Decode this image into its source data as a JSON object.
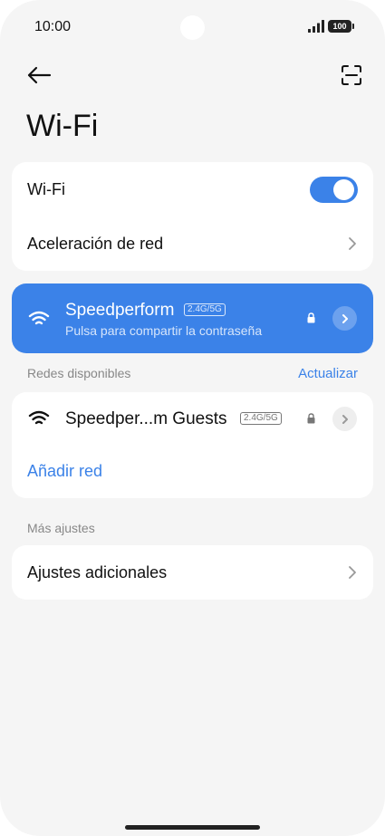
{
  "status_bar": {
    "time": "10:00",
    "battery": "100"
  },
  "header": {
    "title": "Wi-Fi"
  },
  "settings": {
    "wifi_label": "Wi-Fi",
    "wifi_enabled": true,
    "network_acceleration_label": "Aceleración de red"
  },
  "connected_network": {
    "name": "Speedperform",
    "band": "2.4G/5G",
    "subtitle": "Pulsa para compartir la contraseña",
    "secured": true
  },
  "available": {
    "section_label": "Redes disponibles",
    "refresh_label": "Actualizar",
    "networks": [
      {
        "name": "Speedper...m Guests",
        "band": "2.4G/5G",
        "secured": true
      }
    ],
    "add_network_label": "Añadir red"
  },
  "more": {
    "section_label": "Más ajustes",
    "additional_settings_label": "Ajustes adicionales"
  },
  "colors": {
    "accent": "#3b82e8",
    "background": "#f5f5f5",
    "card": "#ffffff",
    "muted_text": "#888888"
  }
}
